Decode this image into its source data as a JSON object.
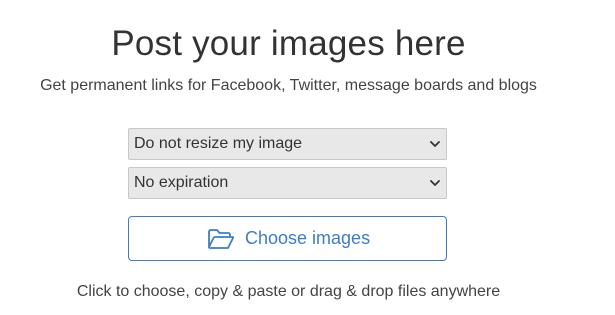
{
  "header": {
    "title": "Post your images here",
    "subtitle": "Get permanent links for Facebook, Twitter, message boards and blogs"
  },
  "options": {
    "resize": {
      "selected": "Do not resize my image",
      "icon": "chevron-down-icon"
    },
    "expiration": {
      "selected": "No expiration",
      "icon": "chevron-down-icon"
    }
  },
  "upload": {
    "button_label": "Choose images",
    "button_icon": "folder-open-icon",
    "hint": "Click to choose, copy & paste or drag & drop files anywhere"
  },
  "colors": {
    "accent": "#3d7cc9",
    "select_background": "#e8e8e8",
    "text": "#333333"
  }
}
